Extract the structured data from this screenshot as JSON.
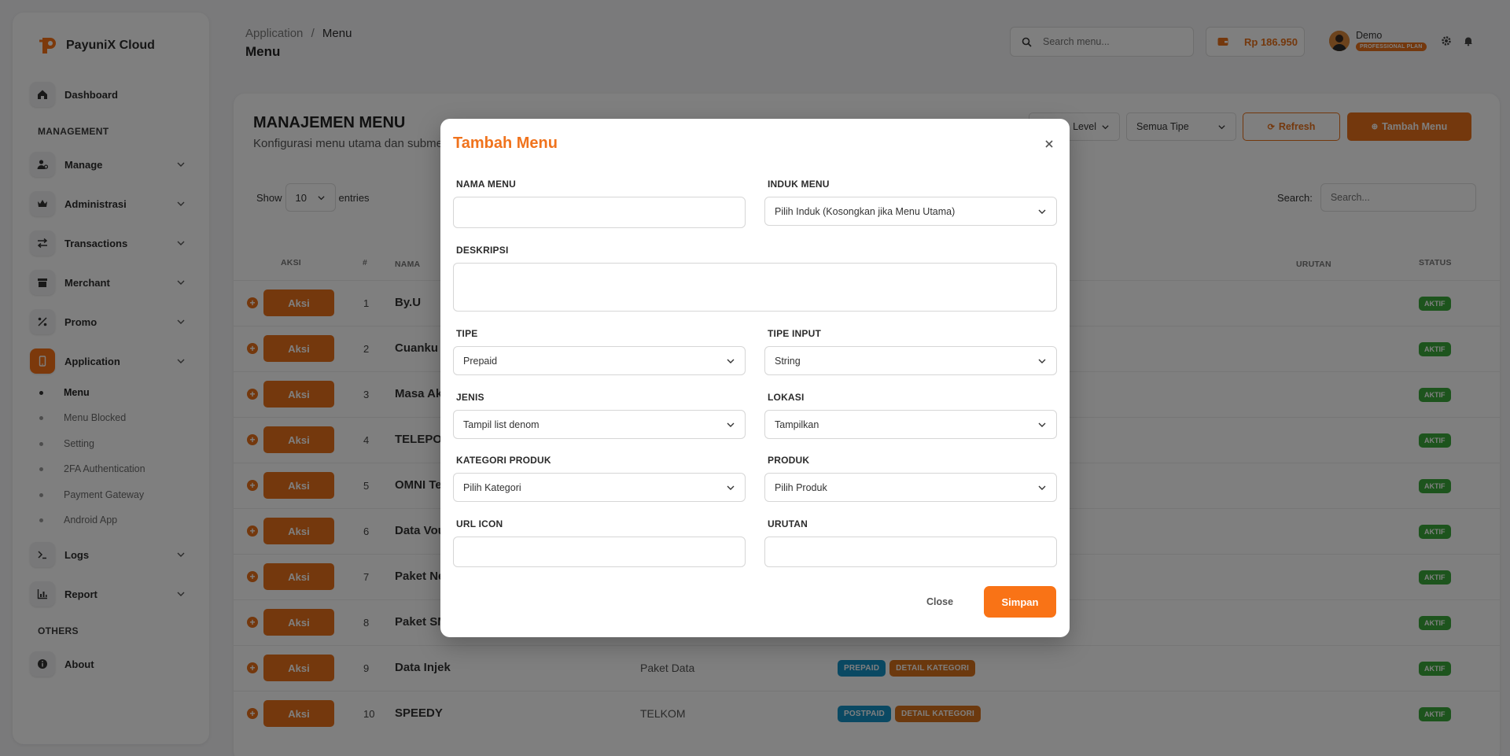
{
  "app": {
    "brand": "PayuniX Cloud"
  },
  "sidebar": {
    "dashboard": "Dashboard",
    "section_management": "MANAGEMENT",
    "items": [
      {
        "label": "Manage"
      },
      {
        "label": "Administrasi"
      },
      {
        "label": "Transactions"
      },
      {
        "label": "Merchant"
      },
      {
        "label": "Promo"
      },
      {
        "label": "Application"
      }
    ],
    "sub_items": [
      "Menu",
      "Menu Blocked",
      "Setting",
      "2FA Authentication",
      "Payment Gateway",
      "Android App"
    ],
    "logs": "Logs",
    "report": "Report",
    "section_others": "OTHERS",
    "about": "About"
  },
  "header": {
    "breadcrumb_parent": "Application",
    "breadcrumb_sep": "/",
    "breadcrumb_current": "Menu",
    "page_title": "Menu",
    "search_placeholder": "Search menu...",
    "balance": "Rp 186.950",
    "user_name": "Demo",
    "user_plan": "PROFESSIONAL PLAN"
  },
  "content": {
    "title": "MANAJEMEN MENU",
    "subtitle": "Konfigurasi menu utama dan submenu",
    "filter_level": "Level",
    "filter_tipe": "Semua Tipe",
    "refresh_label": "Refresh",
    "add_label": "Tambah Menu",
    "show_label": "Show",
    "entries_value": "10",
    "entries_label": "entries",
    "search_label": "Search:",
    "search_placeholder": "Search...",
    "columns": {
      "aksi": "AKSI",
      "num": "#",
      "nama": "NAMA",
      "urutan": "URUTAN",
      "status": "STATUS"
    },
    "aksi_label": "Aksi",
    "rows": [
      {
        "num": "1",
        "name": "By.U",
        "induk": "",
        "tags": [],
        "status": "AKTIF"
      },
      {
        "num": "2",
        "name": "Cuanku",
        "induk": "",
        "tags": [],
        "status": "AKTIF"
      },
      {
        "num": "3",
        "name": "Masa Ak",
        "induk": "",
        "tags": [],
        "status": "AKTIF"
      },
      {
        "num": "4",
        "name": "TELEPO",
        "induk": "",
        "tags": [],
        "status": "AKTIF"
      },
      {
        "num": "5",
        "name": "OMNI Te",
        "induk": "",
        "tags": [],
        "status": "AKTIF"
      },
      {
        "num": "6",
        "name": "Data Vou",
        "induk": "",
        "tags": [],
        "status": "AKTIF"
      },
      {
        "num": "7",
        "name": "Paket Ne",
        "induk": "",
        "tags": [],
        "status": "AKTIF"
      },
      {
        "num": "8",
        "name": "Paket SM",
        "induk": "",
        "tags": [],
        "status": "AKTIF"
      },
      {
        "num": "9",
        "name": "Data Injek",
        "induk": "Paket Data",
        "tags": [
          {
            "label": "PREPAID",
            "color": "blue"
          },
          {
            "label": "DETAIL KATEGORI",
            "color": "orange"
          }
        ],
        "status": "AKTIF"
      },
      {
        "num": "10",
        "name": "SPEEDY",
        "induk": "TELKOM",
        "tags": [
          {
            "label": "POSTPAID",
            "color": "blue"
          },
          {
            "label": "DETAIL KATEGORI",
            "color": "orange"
          }
        ],
        "status": "AKTIF"
      }
    ]
  },
  "modal": {
    "title": "Tambah Menu",
    "nama_menu_label": "NAMA MENU",
    "nama_menu_value": "",
    "induk_menu_label": "INDUK MENU",
    "induk_menu_value": "Pilih Induk (Kosongkan jika Menu Utama)",
    "deskripsi_label": "DESKRIPSI",
    "deskripsi_value": "",
    "tipe_label": "TIPE",
    "tipe_value": "Prepaid",
    "tipe_input_label": "TIPE INPUT",
    "tipe_input_value": "String",
    "jenis_label": "JENIS",
    "jenis_value": "Tampil list denom",
    "lokasi_label": "LOKASI",
    "lokasi_value": "Tampilkan",
    "kategori_label": "KATEGORI PRODUK",
    "kategori_value": "Pilih Kategori",
    "produk_label": "PRODUK",
    "produk_value": "Pilih Produk",
    "url_icon_label": "URL ICON",
    "url_icon_value": "",
    "urutan_label": "URUTAN",
    "urutan_value": "",
    "close_label": "Close",
    "save_label": "Simpan"
  },
  "colors": {
    "accent": "#f97316",
    "accent_dark": "#e8701a",
    "status_green": "#3aa93a",
    "tag_blue": "#1593c7"
  }
}
